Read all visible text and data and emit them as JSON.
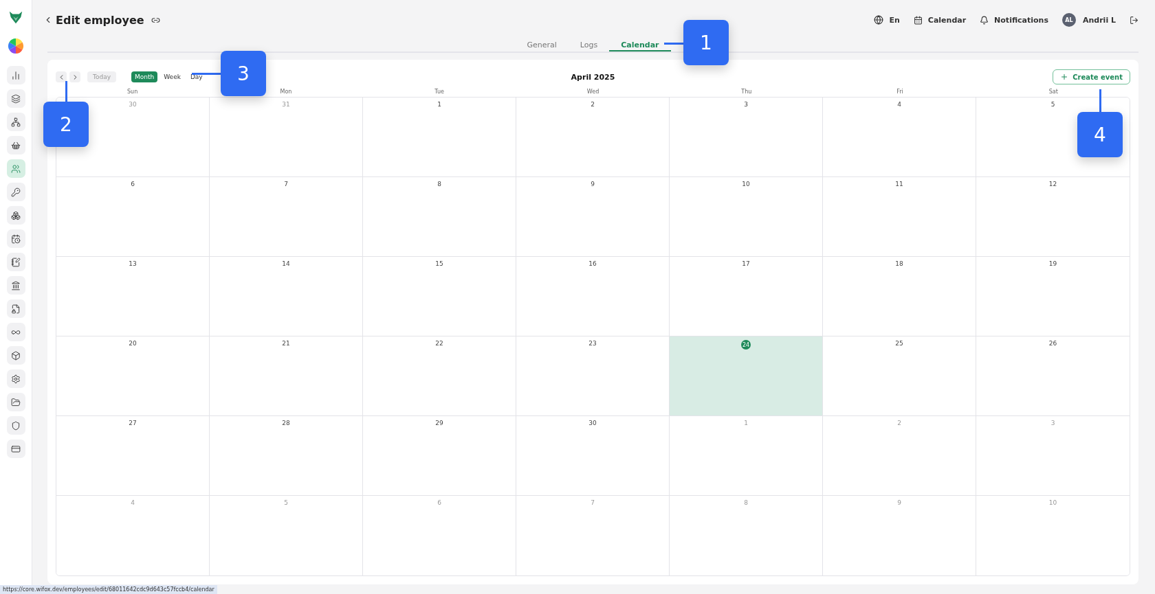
{
  "header": {
    "title": "Edit employee",
    "language": "En",
    "calendar_link": "Calendar",
    "notifications": "Notifications",
    "user": {
      "initials": "AL",
      "name": "Andrii L"
    }
  },
  "tabs": [
    {
      "label": "General",
      "selected": false
    },
    {
      "label": "Logs",
      "selected": false
    },
    {
      "label": "Calendar",
      "selected": true
    }
  ],
  "sidebar": {
    "items": [
      {
        "selected": false
      },
      {
        "selected": false
      },
      {
        "selected": false
      },
      {
        "selected": false
      },
      {
        "selected": true
      },
      {
        "selected": false
      },
      {
        "selected": false
      },
      {
        "selected": false
      },
      {
        "selected": false
      },
      {
        "selected": false
      },
      {
        "selected": false
      },
      {
        "selected": false
      },
      {
        "selected": false
      },
      {
        "selected": false
      },
      {
        "selected": false
      },
      {
        "selected": false
      },
      {
        "selected": false
      }
    ]
  },
  "calendar": {
    "today_button": "Today",
    "views": [
      {
        "label": "Month",
        "selected": true
      },
      {
        "label": "Week",
        "selected": false
      },
      {
        "label": "Day",
        "selected": false
      }
    ],
    "title": "April 2025",
    "create_button": "Create event",
    "weekdays": [
      "Sun",
      "Mon",
      "Tue",
      "Wed",
      "Thu",
      "Fri",
      "Sat"
    ],
    "weeks": [
      [
        {
          "day": "30",
          "outside": true,
          "today": false
        },
        {
          "day": "31",
          "outside": true,
          "today": false
        },
        {
          "day": "1",
          "outside": false,
          "today": false
        },
        {
          "day": "2",
          "outside": false,
          "today": false
        },
        {
          "day": "3",
          "outside": false,
          "today": false
        },
        {
          "day": "4",
          "outside": false,
          "today": false
        },
        {
          "day": "5",
          "outside": false,
          "today": false
        }
      ],
      [
        {
          "day": "6",
          "outside": false,
          "today": false
        },
        {
          "day": "7",
          "outside": false,
          "today": false
        },
        {
          "day": "8",
          "outside": false,
          "today": false
        },
        {
          "day": "9",
          "outside": false,
          "today": false
        },
        {
          "day": "10",
          "outside": false,
          "today": false
        },
        {
          "day": "11",
          "outside": false,
          "today": false
        },
        {
          "day": "12",
          "outside": false,
          "today": false
        }
      ],
      [
        {
          "day": "13",
          "outside": false,
          "today": false
        },
        {
          "day": "14",
          "outside": false,
          "today": false
        },
        {
          "day": "15",
          "outside": false,
          "today": false
        },
        {
          "day": "16",
          "outside": false,
          "today": false
        },
        {
          "day": "17",
          "outside": false,
          "today": false
        },
        {
          "day": "18",
          "outside": false,
          "today": false
        },
        {
          "day": "19",
          "outside": false,
          "today": false
        }
      ],
      [
        {
          "day": "20",
          "outside": false,
          "today": false
        },
        {
          "day": "21",
          "outside": false,
          "today": false
        },
        {
          "day": "22",
          "outside": false,
          "today": false
        },
        {
          "day": "23",
          "outside": false,
          "today": false
        },
        {
          "day": "24",
          "outside": false,
          "today": true
        },
        {
          "day": "25",
          "outside": false,
          "today": false
        },
        {
          "day": "26",
          "outside": false,
          "today": false
        }
      ],
      [
        {
          "day": "27",
          "outside": false,
          "today": false
        },
        {
          "day": "28",
          "outside": false,
          "today": false
        },
        {
          "day": "29",
          "outside": false,
          "today": false
        },
        {
          "day": "30",
          "outside": false,
          "today": false
        },
        {
          "day": "1",
          "outside": true,
          "today": false
        },
        {
          "day": "2",
          "outside": true,
          "today": false
        },
        {
          "day": "3",
          "outside": true,
          "today": false
        }
      ],
      [
        {
          "day": "4",
          "outside": true,
          "today": false
        },
        {
          "day": "5",
          "outside": true,
          "today": false
        },
        {
          "day": "6",
          "outside": true,
          "today": false
        },
        {
          "day": "7",
          "outside": true,
          "today": false
        },
        {
          "day": "8",
          "outside": true,
          "today": false
        },
        {
          "day": "9",
          "outside": true,
          "today": false
        },
        {
          "day": "10",
          "outside": true,
          "today": false
        }
      ]
    ]
  },
  "callouts": [
    "1",
    "2",
    "3",
    "4"
  ],
  "status_url": "https://core.wifox.dev/employees/edit/68011642cdc9d643c57fccb4/calendar"
}
